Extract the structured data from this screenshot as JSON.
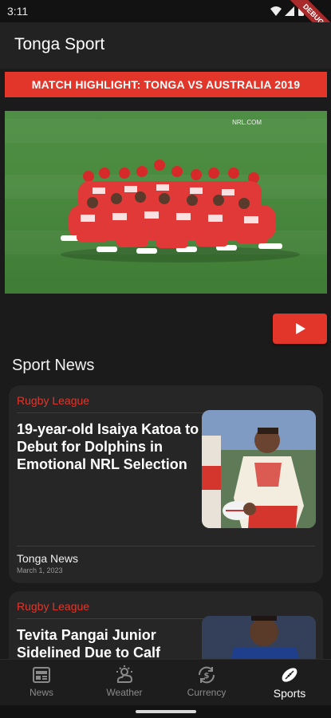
{
  "status_bar": {
    "time": "3:11",
    "debug_label": "DEBUG"
  },
  "app_bar": {
    "title": "Tonga Sport"
  },
  "highlight": {
    "banner": "MATCH HIGHLIGHT: TONGA VS AUSTRALIA 2019",
    "watermark": "NRL.COM",
    "play_icon": "play-icon"
  },
  "section": {
    "title": "Sport News"
  },
  "news": [
    {
      "category": "Rugby League",
      "headline": "19-year-old Isaiya Katoa to Debut for Dolphins in Emotional NRL Selection",
      "source": "Tonga News",
      "date": "March 1, 2023"
    },
    {
      "category": "Rugby League",
      "headline": "Tevita Pangai Junior Sidelined Due to Calf",
      "source": "",
      "date": ""
    }
  ],
  "bottom_nav": {
    "items": [
      {
        "label": "News",
        "icon": "newspaper-icon"
      },
      {
        "label": "Weather",
        "icon": "weather-icon"
      },
      {
        "label": "Currency",
        "icon": "currency-icon"
      },
      {
        "label": "Sports",
        "icon": "rugby-ball-icon"
      }
    ],
    "active": "Sports"
  },
  "colors": {
    "accent": "#e2362b",
    "background": "#1b1b1b",
    "card": "#262626"
  }
}
